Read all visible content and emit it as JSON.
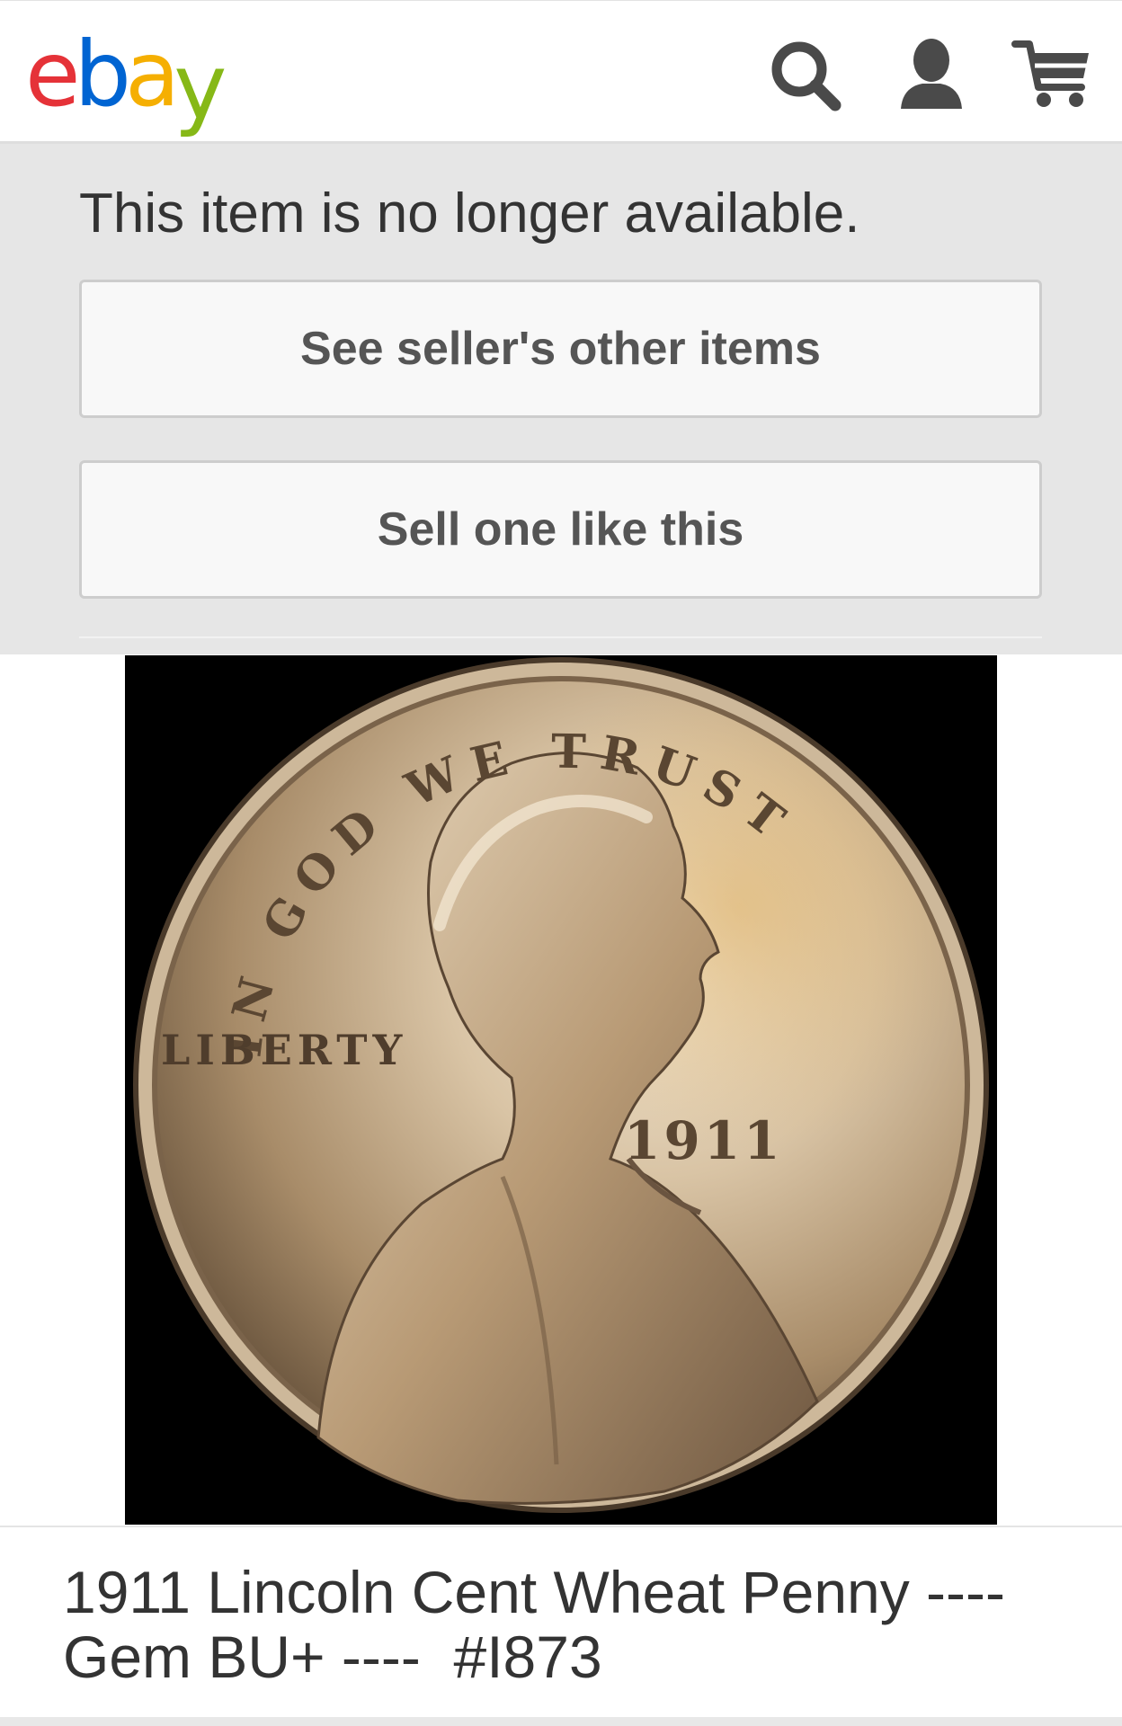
{
  "header": {
    "logo": {
      "e": "e",
      "b": "b",
      "a": "a",
      "y": "y"
    },
    "icons": [
      "search-icon",
      "user-icon",
      "cart-icon"
    ],
    "colors": {
      "logo_e": "#e53238",
      "logo_b": "#0064d2",
      "logo_a": "#f5af02",
      "logo_y": "#86b817",
      "icon": "#4a4a4a"
    }
  },
  "notice": {
    "message": "This item is no longer available.",
    "buttons": {
      "other_items": "See seller's other items",
      "sell_one": "Sell one like this"
    }
  },
  "product": {
    "image": {
      "coin_text": {
        "motto": "IN GOD WE TRUST",
        "liberty": "LIBERTY",
        "year": "1911"
      }
    },
    "title": "1911 Lincoln Cent Wheat Penny ----\nGem BU+ ----  #I873"
  }
}
